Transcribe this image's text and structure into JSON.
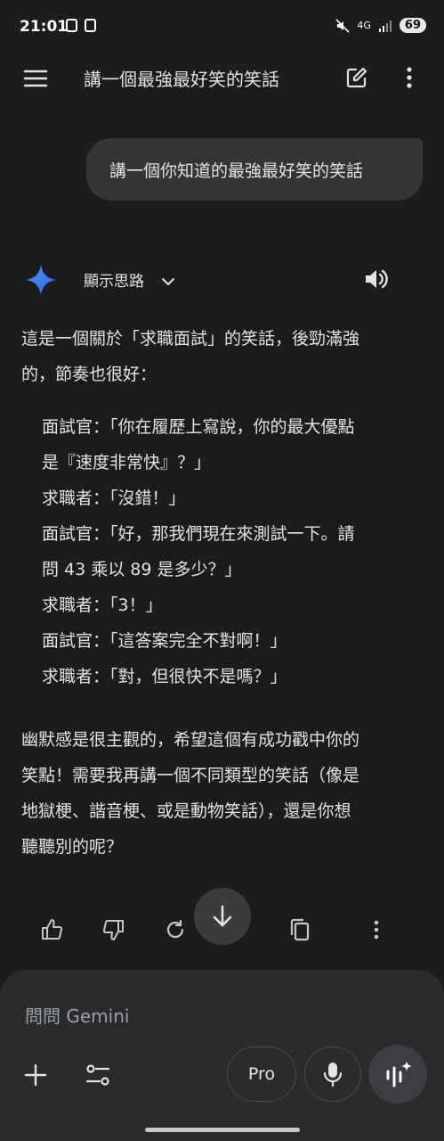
{
  "status": {
    "time": "21:01",
    "network": "4G",
    "battery": "69"
  },
  "header": {
    "title": "講一個最強最好笑的笑話"
  },
  "user_message": "講一個你知道的最強最好笑的笑話",
  "response": {
    "thoughts_label": "顯示思路",
    "intro_line1": "這是一個關於「求職面試」的笑話，後勁滿強",
    "intro_line2": "的，節奏也很好：",
    "joke": [
      "面試官：「你在履歷上寫說，你的最大優點",
      "是『速度非常快』？」",
      "求職者：「沒錯！」",
      "面試官：「好，那我們現在來測試一下。請",
      "問 43 乘以 89 是多少？」",
      "求職者：「3！」",
      "面試官：「這答案完全不對啊！」",
      "求職者：「對，但很快不是嗎？」"
    ],
    "outro": [
      "幽默感是很主觀的，希望這個有成功戳中你的",
      "笑點！需要我再講一個不同類型的笑話（像是",
      "地獄梗、諧音梗、或是動物笑話），還是你想",
      "聽聽別的呢？"
    ]
  },
  "composer": {
    "placeholder": "問問 Gemini",
    "pro_label": "Pro"
  },
  "colors": {
    "background": "#1b1c1d",
    "bubble": "#333537",
    "composer": "#2a2b2d",
    "gemini_blue": "#4f8cff"
  }
}
